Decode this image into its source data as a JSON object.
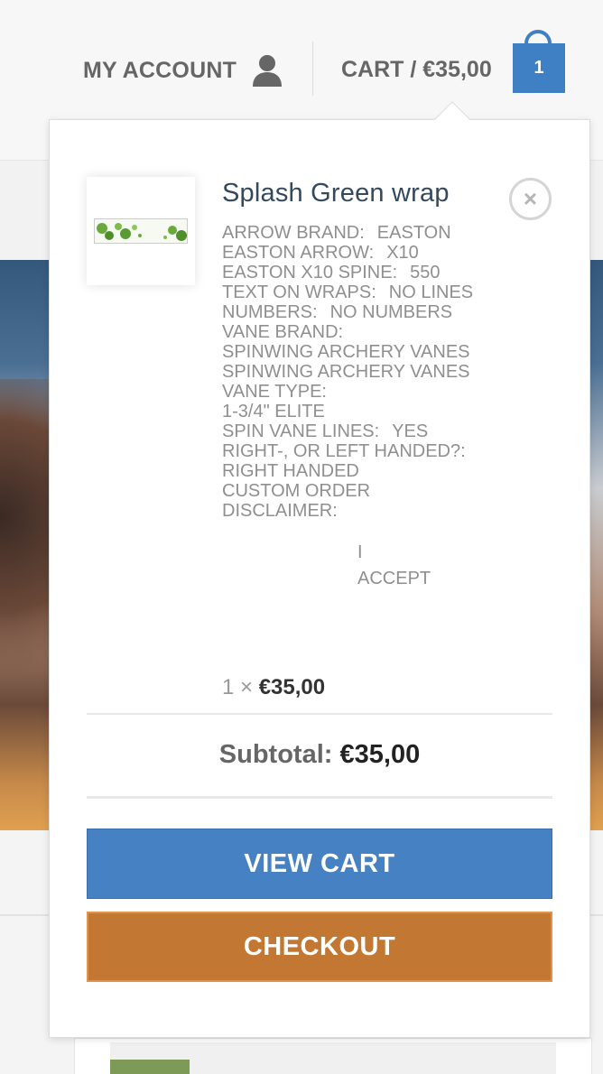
{
  "header": {
    "account_label": "MY ACCOUNT",
    "cart_label": "CART / €35,00",
    "cart_count": "1"
  },
  "cart_item": {
    "title": "Splash Green wrap",
    "remove_glyph": "×",
    "meta": [
      {
        "key": "ARROW BRAND:",
        "value": "EASTON"
      },
      {
        "key": "EASTON ARROW:",
        "value": "X10"
      },
      {
        "key": "EASTON X10 SPINE:",
        "value": "550"
      },
      {
        "key": "TEXT ON WRAPS:",
        "value": "NO LINES"
      },
      {
        "key": "NUMBERS:",
        "value": "NO NUMBERS"
      },
      {
        "key": "VANE BRAND:",
        "value": ""
      },
      {
        "key": "SPINWING ARCHERY VANES",
        "value": ""
      },
      {
        "key": "SPINWING ARCHERY VANES",
        "value": ""
      },
      {
        "key": "VANE TYPE:",
        "value": ""
      },
      {
        "key": "1-3/4\" ELITE",
        "value": ""
      },
      {
        "key": "SPIN VANE LINES:",
        "value": "YES"
      },
      {
        "key": "RIGHT-, OR LEFT HANDED?:",
        "value": ""
      },
      {
        "key": "RIGHT HANDED",
        "value": ""
      },
      {
        "key": "CUSTOM ORDER",
        "value": ""
      },
      {
        "key": "DISCLAIMER:",
        "value": ""
      }
    ],
    "accept_line1": "I",
    "accept_line2": "ACCEPT",
    "qty": "1 ×",
    "price": "€35,00"
  },
  "summary": {
    "subtotal_label": "Subtotal:",
    "subtotal_value": "€35,00"
  },
  "actions": {
    "view_cart": "VIEW CART",
    "checkout": "CHECKOUT"
  },
  "colors": {
    "accent_blue": "#4581c3",
    "checkout_orange": "#c27832"
  }
}
